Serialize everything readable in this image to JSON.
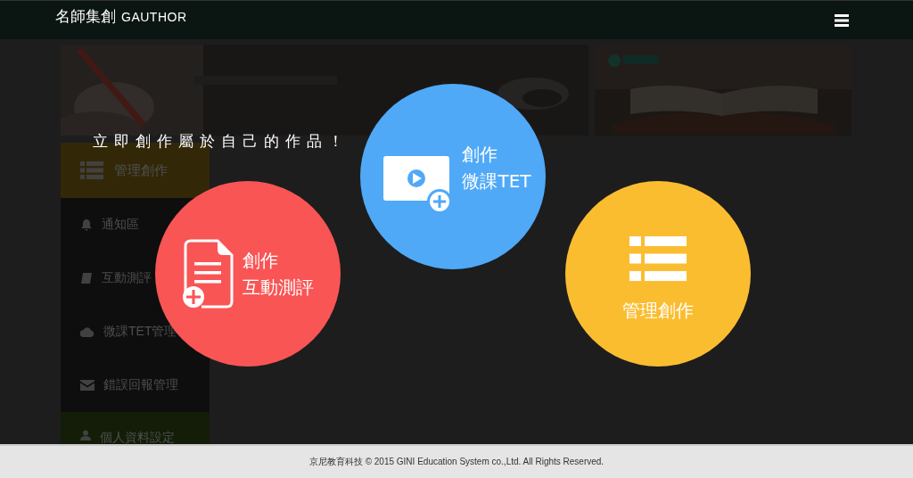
{
  "header": {
    "logo": "名師集創",
    "logo_latin": "GAUTHOR"
  },
  "tagline": "立即創作屬於自己的作品！",
  "sidebar": {
    "items": [
      {
        "label": "管理創作",
        "kind": "list",
        "color": "#3a2e0a"
      },
      {
        "label": "通知區",
        "kind": "bell",
        "color": "#101010"
      },
      {
        "label": "互動測評",
        "kind": "book",
        "color": "#101010"
      },
      {
        "label": "微課TET管理",
        "kind": "cloud",
        "color": "#101010"
      },
      {
        "label": "錯誤回報管理",
        "kind": "mail",
        "color": "#101010"
      },
      {
        "label": "個人資料設定",
        "kind": "user",
        "color": "#16210a"
      }
    ]
  },
  "actions": [
    {
      "kind": "video",
      "lines": [
        "創作",
        "微課TET"
      ],
      "color": "#4fa9f7"
    },
    {
      "kind": "quiz",
      "lines": [
        "創作",
        "互動測評"
      ],
      "color": "#f95555"
    },
    {
      "kind": "manage",
      "lines": [
        "管理創作"
      ],
      "color": "#fbbd30"
    }
  ],
  "footer": {
    "text": "京尼教育科技 © 2015 GINI Education System co.,Ltd. All Rights Reserved."
  }
}
